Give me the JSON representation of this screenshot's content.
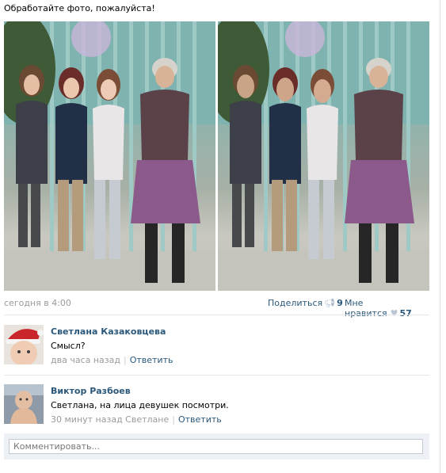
{
  "post": {
    "text": "Обработайте фото, пожалуйста!"
  },
  "photos": [
    {
      "name": "original"
    },
    {
      "name": "edited"
    }
  ],
  "meta": {
    "date": "сегодня в 4:00",
    "share_label": "Поделиться",
    "share_icon": "megaphone-icon",
    "share_count": "9",
    "like_label": "Мне нравится",
    "like_icon": "heart-icon",
    "like_count": "57"
  },
  "comments": [
    {
      "author": "Светлана Казаковцева",
      "text": "Смысл?",
      "time": "два часа назад",
      "reply_label": "Ответить"
    },
    {
      "author": "Виктор Разбоев",
      "text": "Светлана, на лица девушек посмотри.",
      "time": "30 минут назад Светлане",
      "reply_label": "Ответить"
    }
  ],
  "reply_box": {
    "placeholder": "Комментировать..."
  }
}
